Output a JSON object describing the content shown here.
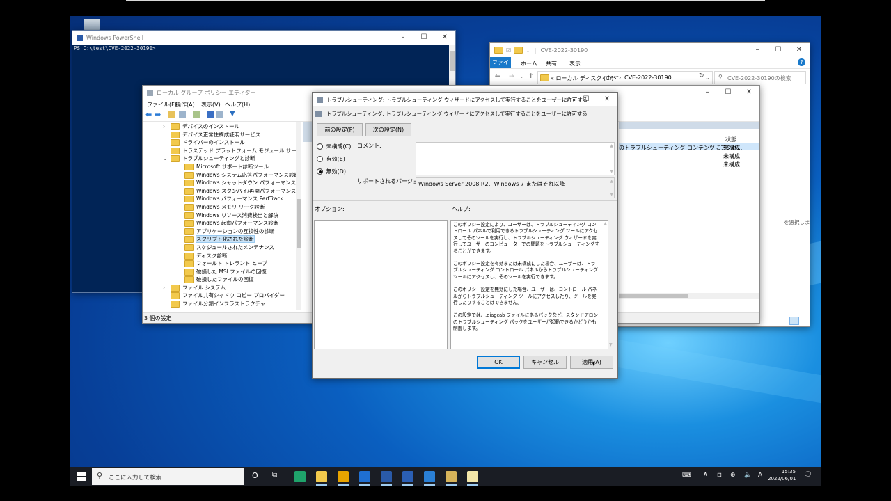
{
  "powershell": {
    "title": "Windows PowerShell",
    "prompt": "PS C:\\test\\CVE-2022-30190>"
  },
  "gpedit": {
    "title": "ローカル グループ ポリシー エディター",
    "menu": [
      "ファイル(F)",
      "操作(A)",
      "表示(V)",
      "ヘルプ(H)"
    ],
    "tree": [
      {
        "label": "デバイスのインストール",
        "indent": 1,
        "expander": "›"
      },
      {
        "label": "デバイス正常性構成証明サービス",
        "indent": 1,
        "expander": ""
      },
      {
        "label": "ドライバーのインストール",
        "indent": 1,
        "expander": ""
      },
      {
        "label": "トラステッド プラットフォーム モジュール サービス",
        "indent": 1,
        "expander": ""
      },
      {
        "label": "トラブルシューティングと診断",
        "indent": 1,
        "expander": "⌄"
      },
      {
        "label": "Microsoft サポート診断ツール",
        "indent": 2,
        "expander": ""
      },
      {
        "label": "Windows システム応答パフォーマンス診断",
        "indent": 2,
        "expander": ""
      },
      {
        "label": "Windows シャットダウン パフォーマンス診断",
        "indent": 2,
        "expander": ""
      },
      {
        "label": "Windows スタンバイ/再開パフォーマンス診断",
        "indent": 2,
        "expander": ""
      },
      {
        "label": "Windows パフォーマンス PerfTrack",
        "indent": 2,
        "expander": ""
      },
      {
        "label": "Windows メモリ リーク診断",
        "indent": 2,
        "expander": ""
      },
      {
        "label": "Windows リソース消費検出と解決",
        "indent": 2,
        "expander": ""
      },
      {
        "label": "Windows 起動パフォーマンス診断",
        "indent": 2,
        "expander": ""
      },
      {
        "label": "アプリケーションの互換性の診断",
        "indent": 2,
        "expander": ""
      },
      {
        "label": "スクリプト化された診断",
        "indent": 2,
        "expander": "",
        "selected": true
      },
      {
        "label": "スケジュールされたメンテナンス",
        "indent": 2,
        "expander": ""
      },
      {
        "label": "ディスク診断",
        "indent": 2,
        "expander": ""
      },
      {
        "label": "フォールト トレラント ヒープ",
        "indent": 2,
        "expander": ""
      },
      {
        "label": "破損した MSI ファイルの回復",
        "indent": 2,
        "expander": ""
      },
      {
        "label": "破損したファイルの回復",
        "indent": 2,
        "expander": ""
      },
      {
        "label": "ファイル システム",
        "indent": 1,
        "expander": "›"
      },
      {
        "label": "ファイル共有シャドウ コピー プロバイダー",
        "indent": 1,
        "expander": ""
      },
      {
        "label": "ファイル分類インフラストラクチャ",
        "indent": 1,
        "expander": ""
      }
    ],
    "status": "3 個の設定"
  },
  "explorer": {
    "title": "CVE-2022-30190",
    "tabs": [
      "ファイル",
      "ホーム",
      "共有",
      "表示"
    ],
    "breadcrumb": [
      "« ローカル ディスク (C:)",
      "test",
      "CVE-2022-30190"
    ],
    "search_placeholder": "CVE-2022-30190の検索",
    "column_state": "状態",
    "row1": "のトラブルシューティング コンテンツにアクセ...",
    "states": [
      "未構成",
      "未構成",
      "未構成"
    ],
    "side_hint": "を選択します。"
  },
  "dialog": {
    "title": "トラブルシューティング: トラブルシューティング ウィザードにアクセスして実行することをユーザーに許可する",
    "header": "トラブルシューティング: トラブルシューティング ウィザードにアクセスして実行することをユーザーに許可する",
    "prev_button": "前の設定(P)",
    "next_button": "次の設定(N)",
    "radio_unconfigured": "未構成(C)",
    "radio_enabled": "有効(E)",
    "radio_disabled": "無効(D)",
    "selected_radio": "disabled",
    "comment_label": "コメント:",
    "supported_label": "サポートされるバージョン:",
    "supported_value": "Windows Server 2008 R2、Windows 7 またはそれ以降",
    "options_label": "オプション:",
    "help_label": "ヘルプ:",
    "help_paragraphs": [
      "このポリシー設定により、ユーザーは、トラブルシューティング コントロール パネルで利用できるトラブルシューティング ツールにアクセスしてそのツールを実行し、トラブルシューティング ウィザードを実行してユーザーのコンピューターでの問題をトラブルシューティングすることができます。",
      "このポリシー設定を有効または未構成にした場合、ユーザーは、トラブルシューティング コントロール パネルからトラブルシューティング ツールにアクセスし、そのツールを実行できます。",
      "このポリシー設定を無効にした場合、ユーザーは、コントロール パネルからトラブルシューティング ツールにアクセスしたり、ツールを実行したりすることはできません。",
      "この設定では、.diagcab ファイルにあるパックなど、スタンドアロンのトラブルシューティング パックをユーザーが起動できるかどうかも制御します。"
    ],
    "ok_button": "OK",
    "cancel_button": "キャンセル",
    "apply_button": "適用(A)"
  },
  "taskbar": {
    "search_placeholder": "ここに入力して検索",
    "time": "15:35",
    "date": "2022/06/01",
    "ime": "A",
    "apps": [
      {
        "name": "edge-icon",
        "color": "#1fa36b"
      },
      {
        "name": "file-explorer-icon",
        "color": "#f2c94c"
      },
      {
        "name": "store-icon",
        "color": "#e8a400"
      },
      {
        "name": "mail-icon",
        "color": "#1f6fd1"
      },
      {
        "name": "powershell-icon",
        "color": "#2a5aa8"
      },
      {
        "name": "word-icon",
        "color": "#2b5fb4"
      },
      {
        "name": "monitor-icon",
        "color": "#2a7fd4"
      },
      {
        "name": "troubleshoot-icon",
        "color": "#d6b35a"
      },
      {
        "name": "notepad-icon",
        "color": "#f3e6a8"
      }
    ]
  }
}
